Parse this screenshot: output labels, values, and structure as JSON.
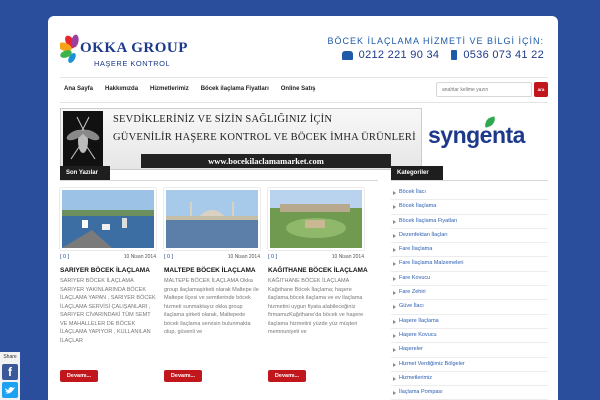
{
  "header": {
    "logo_name": "OKKA GROUP",
    "logo_sub": "HAŞERE KONTROL",
    "contact_title": "BÖCEK İLAÇLAMA HİZMETİ VE BİLGİ İÇİN:",
    "phone": "0212 221 90 34",
    "mobile": "0536 073 41 22"
  },
  "nav": {
    "items": [
      "Ana Sayfa",
      "Hakkımızda",
      "Hizmetlerimiz",
      "Böcek ilaçlama Fiyatları",
      "Online Satış"
    ],
    "search_placeholder": "anahtar kelime yazın",
    "search_button": "ara"
  },
  "banner": {
    "line1": "SEVDİKLERİNİZ VE SİZİN SAĞLIĞINIZ İÇİN",
    "line2": "GÜVENİLİR HAŞERE KONTROL VE BÖCEK İMHA ÜRÜNLERİ",
    "url": "www.bocekilaclamamarket.com",
    "sponsor": "syngenta"
  },
  "recent": {
    "heading": "Son Yazılar",
    "more_label": "Devamı...",
    "posts": [
      {
        "comments": "[ 0 ]",
        "date": "10 Nisan 2014",
        "title": "SARIYER BÖCEK İLAÇLAMA",
        "excerpt": "SARIYER BÖCEK İLAÇLAMA SARIYER YAKINLARINDA BÖCEK İLAÇLAMA YAPAN , SARIYER BÖCEK İLAÇLAMA SERVİSİ ÇALIŞANLARI , SARIYER CİVARINDAKİ TÜM SEMT VE MAHALLELER DE BÖCEK İLAÇLAMA YAPIYOR , KULLANILAN İLAÇLAR"
      },
      {
        "comments": "[ 0 ]",
        "date": "10 Nisan 2014",
        "title": "MALTEPE BÖCEK İLAÇLAMA",
        "excerpt": "MALTEPE BÖCEK İLAÇLAMA Okka group ilaçlamaşirketi olarak Maltepe ile Maltepe ilçesi ve semtlerinde böcek hizmeti sunmaktayız okka group ilaçlama şirketi olarak, Maltepede böcek ilaçlama servisin bulunmakta olup, güvenli ve"
      },
      {
        "comments": "[ 0 ]",
        "date": "10 Nisan 2014",
        "title": "KAĞITHANE BÖCEK İLAÇLAMA",
        "excerpt": "KAĞITHANE BÖCEK İLAÇLAMA Kağıthane Böcek İlaçlama; haşere ilaçlama,böcek ilaçlama ve ev ilaçlama hizmetini uygun fiyata alabileceğiniz firmamızKağıthane'da böcek ve haşere ilaçlama hizmetini yüzde yüz müşteri memnuniyeti ve"
      }
    ]
  },
  "categories": {
    "heading": "Kategoriler",
    "items": [
      "Böcek İlacı",
      "Böcek İlaçlama",
      "Böcek İlaçlama Fiyatları",
      "Dezenfektan İlaçları",
      "Fare İlaçlama",
      "Fare İlaçlama Malzemeleri",
      "Fare Kovucu",
      "Fare Zehiri",
      "Güve İlacı",
      "Haşere İlaçlama",
      "Haşere Kovucu",
      "Haşereler",
      "Hizmet Verdiğimiz Bölgeler",
      "Hizmetlerimiz",
      "İlaçlama Pompası"
    ]
  },
  "share": {
    "label": "Share"
  }
}
